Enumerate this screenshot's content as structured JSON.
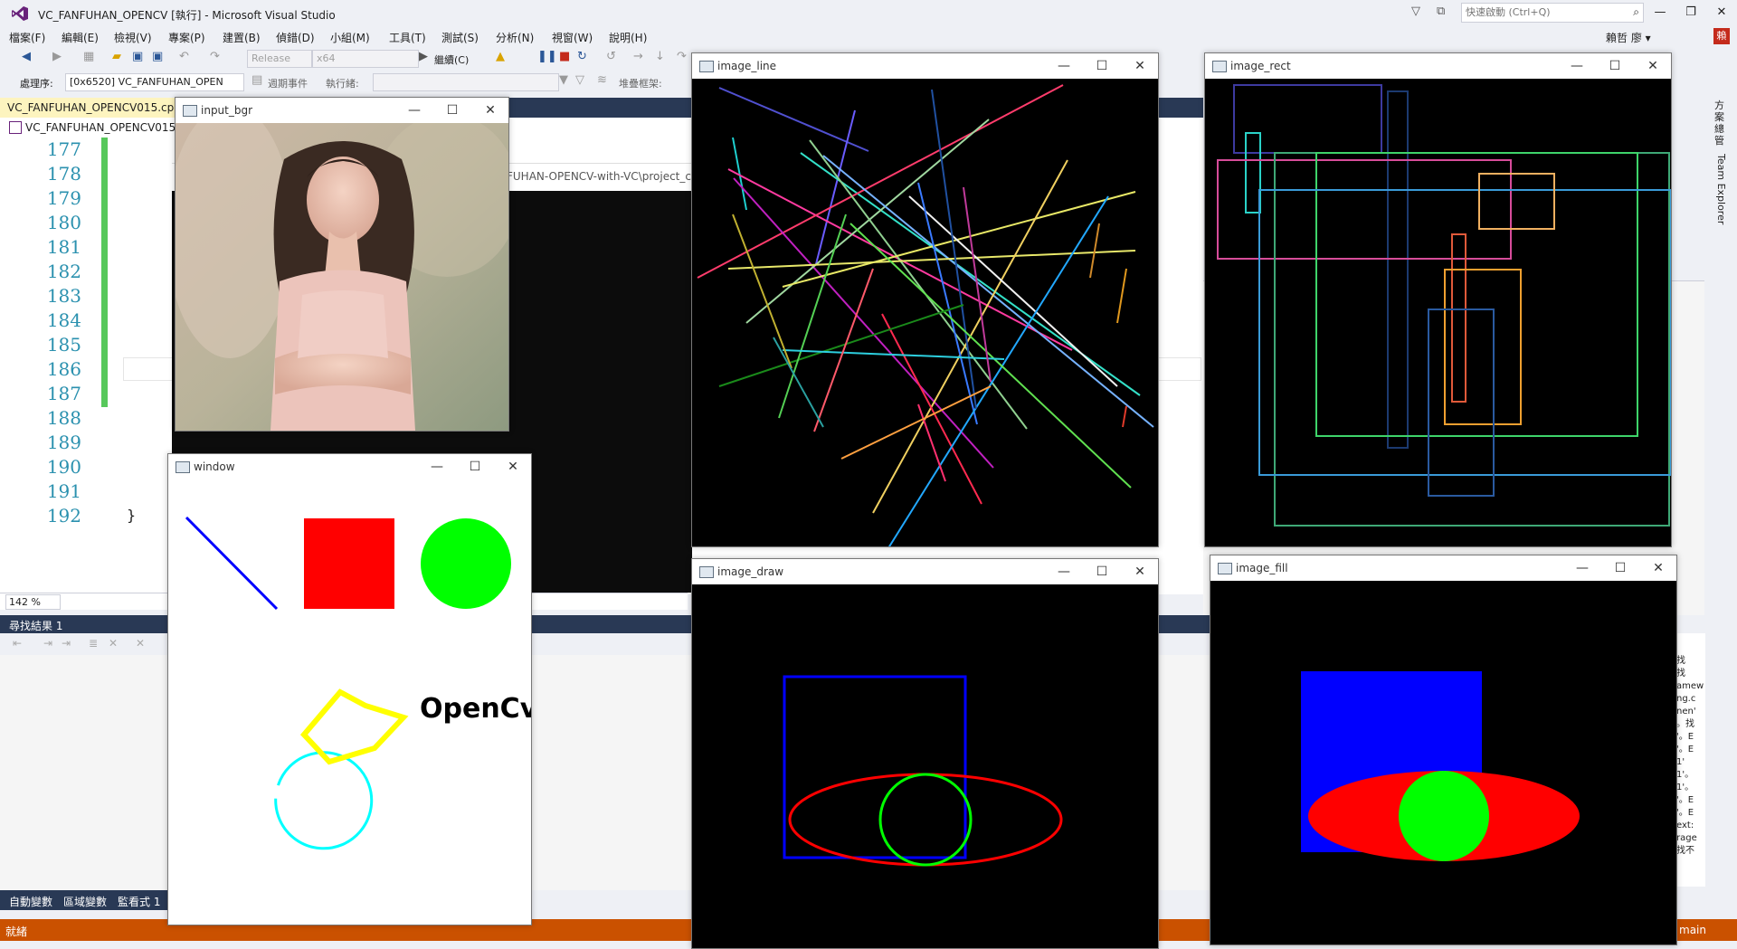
{
  "titlebar": {
    "title": "VC_FANFUHAN_OPENCV [執行] - Microsoft Visual Studio",
    "quick_launch_placeholder": "快速啟動 (Ctrl+Q)",
    "minimize": "—",
    "maximize": "❐",
    "close": "✕"
  },
  "menu": [
    "檔案(F)",
    "編輯(E)",
    "檢視(V)",
    "專案(P)",
    "建置(B)",
    "偵錯(D)",
    "小組(M)",
    "工具(T)",
    "測試(S)",
    "分析(N)",
    "視窗(W)",
    "說明(H)"
  ],
  "user": {
    "name": "賴哲 廖 ▾",
    "badge": "賴"
  },
  "toolbar": {
    "config": "Release",
    "platform": "x64",
    "continue": "繼續(C)",
    "process_label": "處理序:",
    "process_value": "[0x6520] VC_FANFUHAN_OPEN",
    "lifecycle_label": "週期事件",
    "thread_label": "執行緒:",
    "stack_label": "堆疊框架:"
  },
  "editor": {
    "tab": "VC_FANFUHAN_OPENCV015.cpp",
    "nav": "VC_FANFUHAN_OPENCV015",
    "line_numbers": [
      "177",
      "178",
      "179",
      "180",
      "181",
      "182",
      "183",
      "184",
      "185",
      "186",
      "187",
      "188",
      "189",
      "190",
      "191",
      "192"
    ],
    "closing_brace": "}",
    "path_fragment": "FUHAN-OPENCV-with-VC\\project_c",
    "zoom": "142 %"
  },
  "find_panel": {
    "title": "尋找結果 1"
  },
  "bottom_tabs": [
    "自動變數",
    "區域變數",
    "監看式 1"
  ],
  "status": {
    "text": "就緒",
    "branch": "main"
  },
  "right_dock": {
    "solution": "方案總管",
    "team": "Team Explorer"
  },
  "right_panel_lines": [
    "找",
    "找",
    "amew",
    "ng.c",
    "nen'",
    "。找",
    "'。E",
    "'。E",
    "1'",
    "1'。",
    "1'。",
    "'。E",
    "'。E",
    "ext:",
    "rage",
    "找不"
  ],
  "windows": {
    "input_bgr": "input_bgr",
    "window": "window",
    "window_text": "OpenCv",
    "image_line": "image_line",
    "image_rect": "image_rect",
    "image_draw": "image_draw",
    "image_fill": "image_fill"
  },
  "colors": {
    "accent": "#68217a",
    "statusbar": "#ca5100",
    "tabstrip": "#293955",
    "line_numbers": "#2b91af",
    "change_bar": "#57c85b"
  }
}
